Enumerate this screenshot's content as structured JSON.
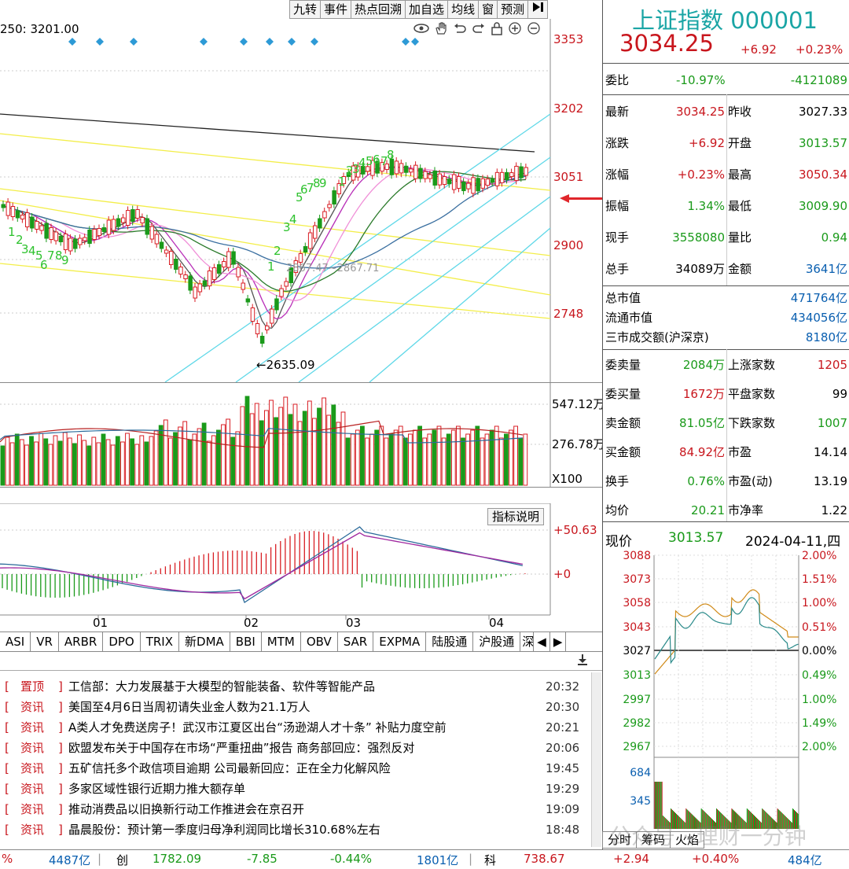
{
  "toolbar": [
    "九转",
    "事件",
    "热点回溯",
    "加自选",
    "均线",
    "窗",
    "预测"
  ],
  "main_chart": {
    "ma_label": "250: 3201.00",
    "price_axis": [
      "3353",
      "3202",
      "3051",
      "2900",
      "2748"
    ],
    "low_label": "←2635.09",
    "gap_label": "2867.47~2867.71",
    "seq_labels_left": [
      "1",
      "2",
      "3",
      "4",
      "5",
      "6",
      "7",
      "8",
      "9"
    ],
    "seq_labels_up": [
      "1",
      "2",
      "3",
      "4",
      "5",
      "6",
      "7",
      "8",
      "9"
    ],
    "seq_labels_top": [
      "1",
      "2",
      "3",
      "4",
      "5",
      "6",
      "7",
      "8"
    ]
  },
  "volume_chart": {
    "axis": [
      "547.12万",
      "276.78万"
    ],
    "unit": "X100"
  },
  "macd_chart": {
    "button": "指标说明",
    "axis": [
      "+50.63",
      "+0"
    ],
    "months": [
      "01",
      "02",
      "03",
      "04"
    ]
  },
  "indicator_tabs": [
    "ASI",
    "VR",
    "ARBR",
    "DPO",
    "TRIX",
    "新DMA",
    "BBI",
    "MTM",
    "OBV",
    "SAR",
    "EXPMA",
    "陆股通",
    "沪股通",
    "深"
  ],
  "quote": {
    "name": "上证指数",
    "code": "000001",
    "price": "3034.25",
    "change": "+6.92",
    "change_pct": "+0.23%",
    "weibi_label": "委比",
    "weibi_pct": "-10.97%",
    "weibi_diff": "-4121089",
    "rows": [
      {
        "l1": "最新",
        "v1": "3034.25",
        "c1": "red",
        "l2": "昨收",
        "v2": "3027.33",
        "c2": "black"
      },
      {
        "l1": "涨跌",
        "v1": "+6.92",
        "c1": "red",
        "l2": "开盘",
        "v2": "3013.57",
        "c2": "green"
      },
      {
        "l1": "涨幅",
        "v1": "+0.23%",
        "c1": "red",
        "l2": "最高",
        "v2": "3050.34",
        "c2": "red"
      },
      {
        "l1": "振幅",
        "v1": "1.34%",
        "c1": "green",
        "l2": "最低",
        "v2": "3009.90",
        "c2": "green"
      },
      {
        "l1": "现手",
        "v1": "3558080",
        "c1": "green",
        "l2": "量比",
        "v2": "0.94",
        "c2": "green"
      },
      {
        "l1": "总手",
        "v1": "34089万",
        "c1": "black",
        "l2": "金额",
        "v2": "3641亿",
        "c2": "blue"
      }
    ],
    "caps": [
      {
        "l": "总市值",
        "v": "471764亿"
      },
      {
        "l": "流通市值",
        "v": "434056亿"
      },
      {
        "l": "三市成交额(沪深京)",
        "v": "8180亿"
      }
    ],
    "orders": [
      {
        "l1": "委卖量",
        "v1": "2084万",
        "c1": "green",
        "l2": "上涨家数",
        "v2": "1205",
        "c2": "red"
      },
      {
        "l1": "委买量",
        "v1": "1672万",
        "c1": "red",
        "l2": "平盘家数",
        "v2": "99",
        "c2": "black"
      },
      {
        "l1": "卖金额",
        "v1": "81.05亿",
        "c1": "green",
        "l2": "下跌家数",
        "v2": "1007",
        "c2": "green"
      },
      {
        "l1": "买金额",
        "v1": "84.92亿",
        "c1": "red",
        "l2": "市盈",
        "v2": "14.14",
        "c2": "black"
      },
      {
        "l1": "换手",
        "v1": "0.76%",
        "c1": "green",
        "l2": "市盈(动)",
        "v2": "13.19",
        "c2": "black"
      },
      {
        "l1": "均价",
        "v1": "20.21",
        "c1": "green",
        "l2": "市净率",
        "v2": "1.22",
        "c2": "black"
      }
    ]
  },
  "intraday": {
    "label": "现价",
    "value": "3013.57",
    "date": "2024-04-11,四",
    "left_axis": [
      "3088",
      "3073",
      "3058",
      "3043",
      "3027",
      "3013",
      "2997",
      "2982",
      "2967"
    ],
    "right_axis": [
      "2.00%",
      "1.51%",
      "1.00%",
      "0.51%",
      "0.00%",
      "0.49%",
      "1.00%",
      "1.49%",
      "2.00%"
    ],
    "vol_axis": [
      "684",
      "345"
    ],
    "tabs": [
      "分时",
      "筹码",
      "火焰"
    ]
  },
  "news": [
    {
      "tag": "置顶",
      "title": "工信部：大力发展基于大模型的智能装备、软件等智能产品",
      "time": "20:32"
    },
    {
      "tag": "资讯",
      "title": "美国至4月6日当周初请失业金人数为21.1万人",
      "time": "20:30"
    },
    {
      "tag": "资讯",
      "title": "A类人才免费送房子！武汉市江夏区出台“汤逊湖人才十条” 补贴力度空前",
      "time": "20:21"
    },
    {
      "tag": "资讯",
      "title": "欧盟发布关于中国存在市场“严重扭曲”报告 商务部回应：强烈反对",
      "time": "20:06"
    },
    {
      "tag": "资讯",
      "title": "五矿信托多个政信项目逾期 公司最新回应：正在全力化解风险",
      "time": "19:45"
    },
    {
      "tag": "资讯",
      "title": "多家区域性银行近期力推大额存单",
      "time": "19:29"
    },
    {
      "tag": "资讯",
      "title": "推动消费品以旧换新行动工作推进会在京召开",
      "time": "19:09"
    },
    {
      "tag": "资讯",
      "title": "晶晨股份：预计第一季度归母净利润同比增长310.68%左右",
      "time": "18:48"
    }
  ],
  "ticker": {
    "a_pct": "%",
    "a_amt": "4487亿",
    "b_name": "创",
    "b_val": "1782.09",
    "b_chg": "-7.85",
    "b_pct": "-0.44%",
    "b_amt": "1801亿",
    "c_name": "科",
    "c_val": "738.67",
    "c_chg": "+2.94",
    "c_pct": "+0.40%",
    "c_amt": "484亿"
  },
  "watermark": "公众号 · 理财一分钟"
}
